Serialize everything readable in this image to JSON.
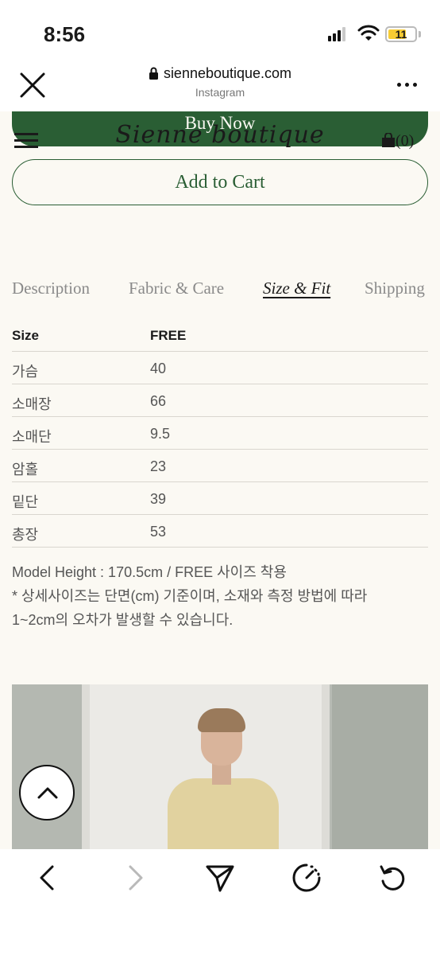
{
  "status_bar": {
    "time": "8:56",
    "battery_level": "11",
    "icons": [
      "signal-icon",
      "wifi-icon",
      "battery-icon"
    ]
  },
  "browser": {
    "url": "sienneboutique.com",
    "subtitle": "Instagram",
    "icons": [
      "close-icon",
      "lock-icon",
      "more-icon"
    ]
  },
  "site": {
    "brand": "Sienne boutique",
    "cart_count": "(0)",
    "buy_now": "Buy Now",
    "add_to_cart": "Add to Cart",
    "accent_color": "#2a5e34"
  },
  "tabs": [
    {
      "label": "Description",
      "active": false
    },
    {
      "label": "Fabric & Care",
      "active": false
    },
    {
      "label": "Size & Fit",
      "active": true
    },
    {
      "label": "Shipping",
      "active": false
    }
  ],
  "size_table": {
    "headers": [
      "Size",
      "FREE"
    ],
    "rows": [
      [
        "가슴",
        "40"
      ],
      [
        "소매장",
        "66"
      ],
      [
        "소매단",
        "9.5"
      ],
      [
        "암홀",
        "23"
      ],
      [
        "밑단",
        "39"
      ],
      [
        "총장",
        "53"
      ]
    ]
  },
  "notes": [
    "Model Height : 170.5cm / FREE 사이즈 착용",
    "* 상세사이즈는 단면(cm) 기준이며, 소재와 측정 방법에 따라",
    "1~2cm의 오차가 발생할 수 있습니다."
  ],
  "toolbar": {
    "icons": [
      "back-icon",
      "forward-icon",
      "share-icon",
      "speed-icon",
      "reload-icon"
    ]
  }
}
